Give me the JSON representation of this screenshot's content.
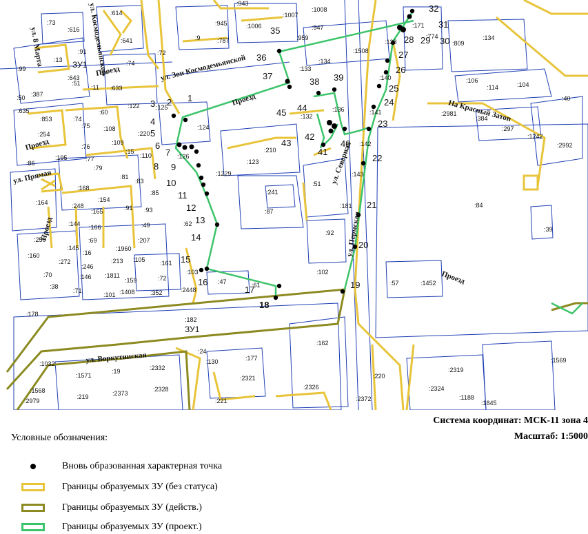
{
  "colors": {
    "zu_no_status": "#e8c43a",
    "zu_active": "#8c8a20",
    "zu_project": "#3cc46a",
    "parcel_line": "#1f3fb4",
    "point": "#000000"
  },
  "map": {
    "streets": [
      "ул. Зои Космодемьянской",
      "ул. Космодемьянской",
      "ул. 8 Марта",
      "Проезд",
      "ул. Прямая",
      "Проезд",
      "Проезд",
      "Проезд",
      "ул. Северная",
      "ул. Пермская",
      "На Красный Затон",
      "ул. Воркутинская",
      "Проезд"
    ],
    "zu_labels": [
      "ЗУ1",
      "ЗУ1"
    ],
    "cadastral_labels": [
      ":943",
      ":614",
      ":1007",
      ":1008",
      ":73",
      ":616",
      ":945",
      ":1006",
      ":947",
      ":171",
      ":13",
      ":91",
      ":641",
      ":787",
      ":9",
      ":959",
      ":1508",
      ":138",
      ":774",
      ":809",
      ":134",
      ":99",
      ":643",
      ":74",
      ":72",
      ":133",
      ":134",
      ":51",
      ":11",
      ":633",
      ":140",
      ":106",
      ":114",
      ":104",
      ":387",
      ":122",
      ":125",
      ":40",
      ":50",
      ":60",
      ":136",
      ":141",
      ":2981",
      ":384",
      ":297",
      ":1242",
      ":635",
      ":853",
      ":74",
      ":108",
      ":132",
      ":124",
      ":2992",
      ":220",
      ":254",
      ":75",
      ":109",
      ":15",
      ":142",
      ":76",
      ":210",
      ":126",
      ":110",
      ":86",
      ":195",
      ":77",
      ":79",
      ":123",
      ":1229",
      ":143",
      ":81",
      ":83",
      ":85",
      ":51",
      ":241",
      ":168",
      ":164",
      ":154",
      ":84",
      ":248",
      ":165",
      ":91",
      ":93",
      ":87",
      ":181",
      ":144",
      ":166",
      ":49",
      ":62",
      ":39",
      ":250",
      ":69",
      ":92",
      ":145",
      ":16",
      ":1960",
      ":207",
      ":160",
      ":272",
      ":213",
      ":105",
      ":161",
      ":246",
      ":102",
      ":70",
      ":146",
      ":1811",
      ":103",
      ":38",
      ":71",
      ":101",
      ":1408",
      ":159",
      ":72",
      ":47",
      ":61",
      ":57",
      ":1452",
      ":2448",
      ":352",
      ":178",
      ":182",
      ":162",
      ":1032",
      ":24",
      ":130",
      ":177",
      ":1569",
      ":1571",
      ":19",
      ":2332",
      ":2319",
      ":2321",
      ":220",
      ":1568",
      ":219",
      ":2373",
      ":2328",
      ":2326",
      ":2324",
      ":1188",
      ":2979",
      ":221",
      ":2372",
      ":1845",
      ":264",
      ":222"
    ],
    "points": [
      "1",
      "2",
      "3",
      "4",
      "5",
      "6",
      "7",
      "8",
      "9",
      "10",
      "11",
      "12",
      "13",
      "14",
      "15",
      "16",
      "17",
      "18",
      "19",
      "20",
      "21",
      "22",
      "23",
      "24",
      "25",
      "26",
      "27",
      "28",
      "29",
      "30",
      "31",
      "32",
      "35",
      "36",
      "37",
      "38",
      "39",
      "40",
      "41",
      "42",
      "43",
      "44",
      "45"
    ]
  },
  "coordinate_system": "Система координат: МСК-11 зона 4",
  "scale": "Масштаб: 1:5000",
  "legend": {
    "title": "Условные обозначения:",
    "items": [
      {
        "label": "Вновь образованная характерная точка",
        "symbol": "point"
      },
      {
        "label": "Границы образуемых ЗУ (без статуса)",
        "symbol": "zu_no_status"
      },
      {
        "label": "Границы образуемых ЗУ (действ.)",
        "symbol": "zu_active"
      },
      {
        "label": "Границы образуемых ЗУ (проект.)",
        "symbol": "zu_project"
      }
    ]
  }
}
